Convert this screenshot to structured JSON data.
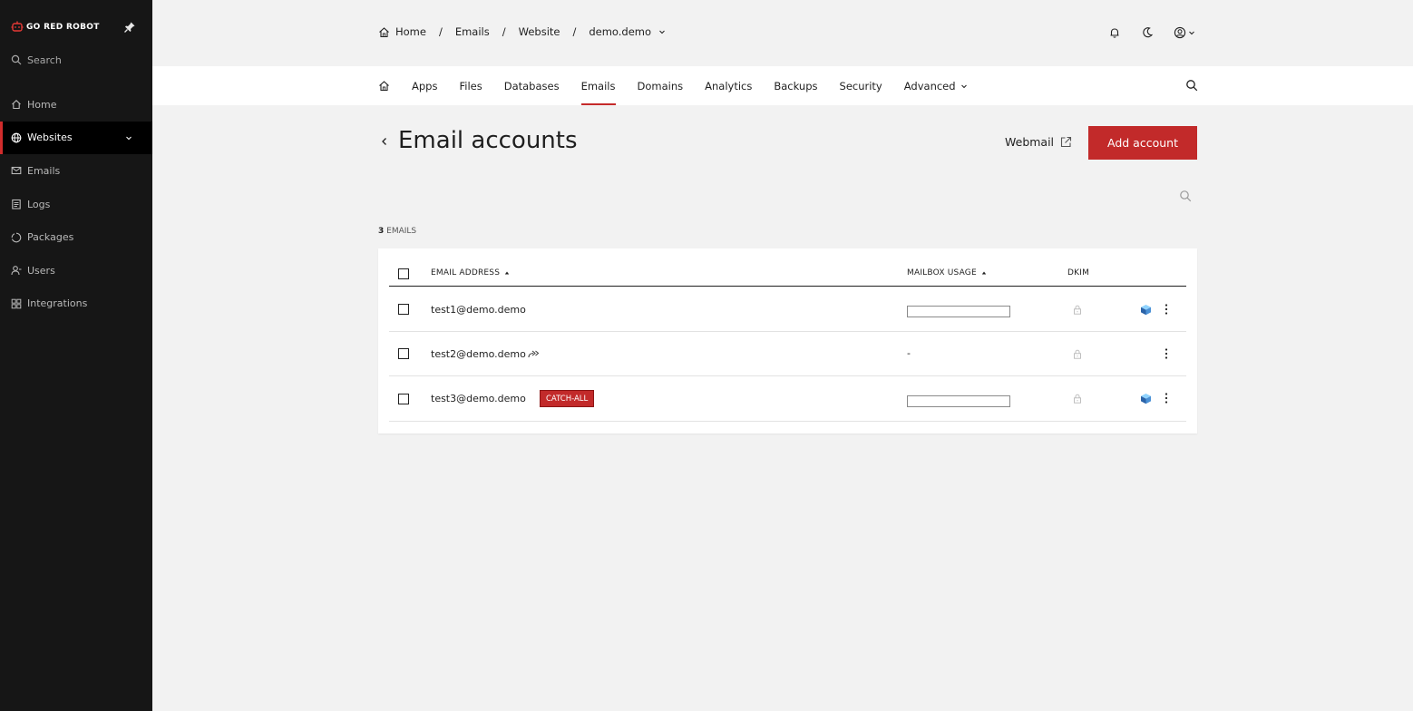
{
  "sidebar": {
    "brand": "GO RED ROBOT",
    "search_label": "Search",
    "items": [
      {
        "label": "Home",
        "icon": "home-icon",
        "active": false
      },
      {
        "label": "Websites",
        "icon": "globe-icon",
        "active": true
      },
      {
        "label": "Emails",
        "icon": "mail-icon",
        "active": false
      },
      {
        "label": "Logs",
        "icon": "logs-icon",
        "active": false
      },
      {
        "label": "Packages",
        "icon": "package-icon",
        "active": false
      },
      {
        "label": "Users",
        "icon": "users-icon",
        "active": false
      },
      {
        "label": "Integrations",
        "icon": "integrations-icon",
        "active": false
      }
    ]
  },
  "breadcrumb": {
    "items": [
      "Home",
      "Emails",
      "Website",
      "demo.demo"
    ],
    "separator": "/"
  },
  "tabs": [
    {
      "label": "Apps",
      "active": false
    },
    {
      "label": "Files",
      "active": false
    },
    {
      "label": "Databases",
      "active": false
    },
    {
      "label": "Emails",
      "active": true
    },
    {
      "label": "Domains",
      "active": false
    },
    {
      "label": "Analytics",
      "active": false
    },
    {
      "label": "Backups",
      "active": false
    },
    {
      "label": "Security",
      "active": false
    },
    {
      "label": "Advanced",
      "active": false,
      "dropdown": true
    }
  ],
  "page": {
    "title": "Email accounts",
    "webmail_label": "Webmail",
    "add_button_label": "Add account",
    "count_number": "3",
    "count_label": "EMAILS"
  },
  "table": {
    "columns": {
      "email": "EMAIL ADDRESS",
      "usage": "MAILBOX USAGE",
      "dkim": "DKIM"
    },
    "rows": [
      {
        "email": "test1@demo.demo",
        "forward": false,
        "badge": "",
        "usage": "bar",
        "usage_fraction": 0,
        "cube": true
      },
      {
        "email": "test2@demo.demo",
        "forward": true,
        "badge": "",
        "usage": "-",
        "usage_fraction": null,
        "cube": false
      },
      {
        "email": "test3@demo.demo",
        "forward": false,
        "badge": "CATCH-ALL",
        "usage": "bar",
        "usage_fraction": 0,
        "cube": true
      }
    ]
  },
  "colors": {
    "accent": "#c22a2a",
    "sidebar_bg": "#161616",
    "page_bg": "#f2f2f2"
  }
}
